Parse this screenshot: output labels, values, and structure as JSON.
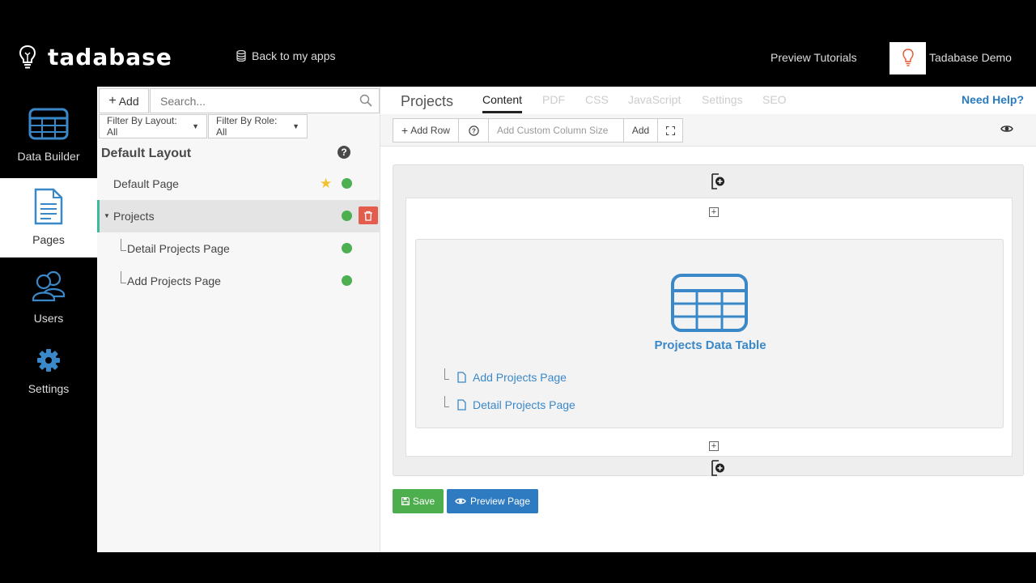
{
  "app": {
    "logo_text": "tadabase",
    "back_link": "Back to my apps",
    "preview_tutorials": "Preview Tutorials",
    "user_name": "Tadabase Demo",
    "brand_color": "#2a7abf"
  },
  "leftnav": {
    "items": [
      {
        "label": "Data Builder",
        "icon": "table-icon"
      },
      {
        "label": "Pages",
        "icon": "document-icon"
      },
      {
        "label": "Users",
        "icon": "users-icon"
      },
      {
        "label": "Settings",
        "icon": "gear-icon"
      }
    ]
  },
  "pages_panel": {
    "add_label": "Add",
    "search_placeholder": "Search...",
    "filter_layout": "Filter By Layout: All",
    "filter_role": "Filter By Role: All",
    "layout_title": "Default Layout",
    "pages": [
      {
        "label": "Default Page"
      },
      {
        "label": "Projects"
      },
      {
        "label": "Detail Projects Page"
      },
      {
        "label": "Add Projects Page"
      }
    ]
  },
  "editor": {
    "page_title": "Projects",
    "tabs": [
      "Content",
      "PDF",
      "CSS",
      "JavaScript",
      "Settings",
      "SEO"
    ],
    "need_help": "Need Help?",
    "toolbar": {
      "add_row": "Add Row",
      "column_placeholder": "Add Custom Column Size",
      "add_label": "Add"
    },
    "component": {
      "title": "Projects Data Table",
      "links": [
        "Add Projects Page",
        "Detail Projects Page"
      ]
    },
    "save_label": "Save",
    "preview_label": "Preview Page"
  }
}
